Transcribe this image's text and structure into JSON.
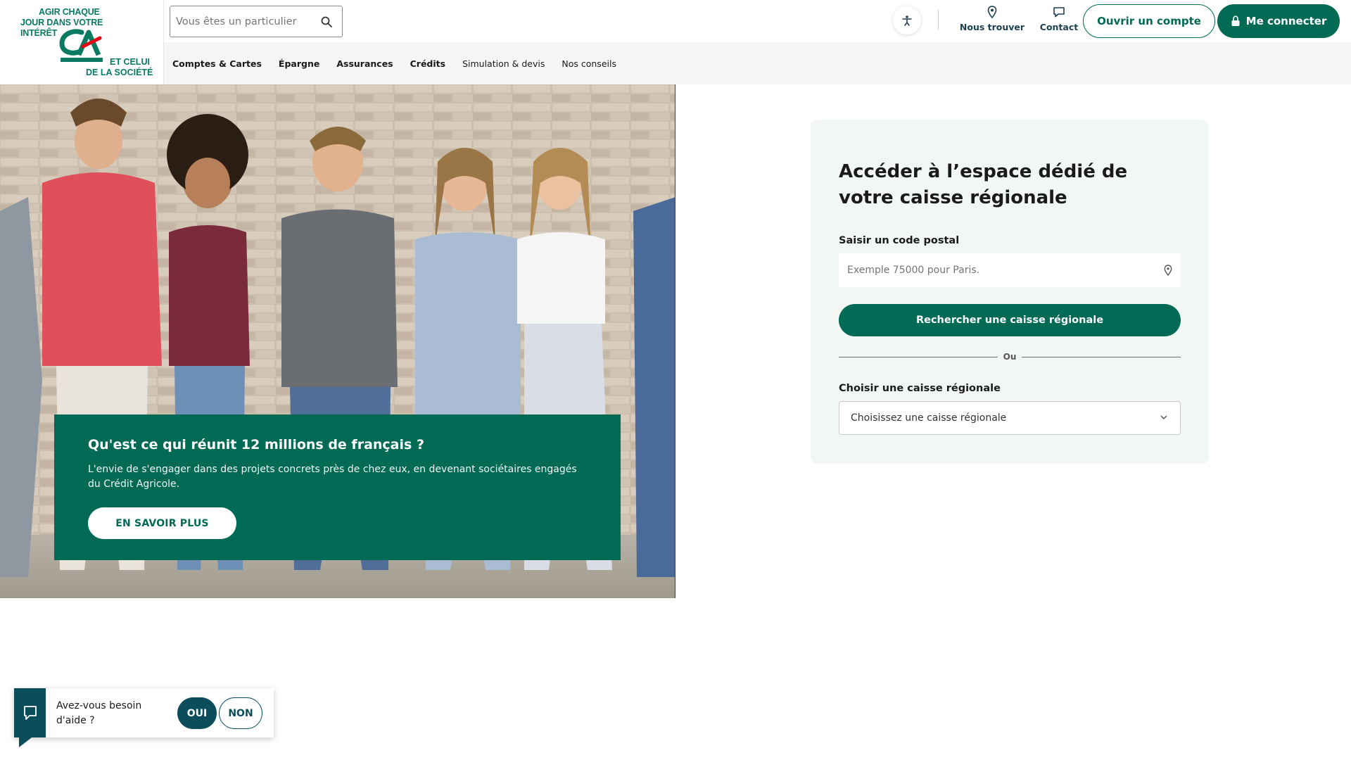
{
  "logo": {
    "tagline_top_1": "Agir chaque",
    "tagline_top_2": "jour dans votre",
    "tagline_top_3": "intérêt",
    "tagline_bottom_1": "et celui",
    "tagline_bottom_2": "de la société",
    "icon": "credit-agricole-logo"
  },
  "header": {
    "search_placeholder": "Vous êtes un particulier",
    "nav_find": "Nous trouver",
    "nav_contact": "Contact",
    "open_account": "Ouvrir un compte",
    "login": "Me connecter"
  },
  "menu": {
    "items": [
      {
        "label": "Comptes & Cartes",
        "bold": true
      },
      {
        "label": "Épargne",
        "bold": true
      },
      {
        "label": "Assurances",
        "bold": true
      },
      {
        "label": "Crédits",
        "bold": true
      },
      {
        "label": "Simulation & devis",
        "bold": false
      },
      {
        "label": "Nos conseils",
        "bold": false
      }
    ]
  },
  "hero": {
    "title": "Qu'est ce qui réunit 12 millions de français ?",
    "text": "L'envie de s'engager dans des projets concrets près de chez eux, en devenant sociétaires engagés du Crédit Agricole.",
    "button": "EN SAVOIR PLUS"
  },
  "region": {
    "title": "Accéder à l’espace dédié de votre caisse régionale",
    "postal_label": "Saisir un code postal",
    "postal_placeholder": "Exemple 75000 pour Paris.",
    "search_button": "Rechercher une caisse régionale",
    "or": "Ou",
    "choose_label": "Choisir une caisse régionale",
    "choose_value": "Choisissez une caisse régionale"
  },
  "help": {
    "question": "Avez-vous besoin d'aide ?",
    "yes": "OUI",
    "no": "NON"
  },
  "colors": {
    "brand_green": "#006a55",
    "help_blue": "#0c4d5c",
    "menu_bg": "#f5f5f5",
    "card_bg": "#f2f7f4"
  }
}
